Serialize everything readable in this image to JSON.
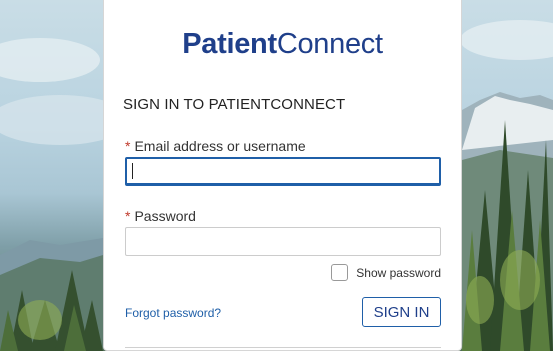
{
  "logo": {
    "part1": "Patient",
    "part2": "Connect"
  },
  "form": {
    "heading": "SIGN IN TO PATIENTCONNECT",
    "required_marker": "*",
    "email_label": "Email address or username",
    "email_value": "",
    "password_label": "Password",
    "password_value": "",
    "show_password_label": "Show password",
    "show_password_checked": false,
    "forgot_link": "Forgot password?",
    "sign_in_button": "SIGN IN"
  },
  "colors": {
    "brand": "#1f3f8a",
    "link": "#1f5fa8",
    "required": "#c0392b"
  },
  "icons": {
    "background": "mountain-forest-landscape"
  }
}
